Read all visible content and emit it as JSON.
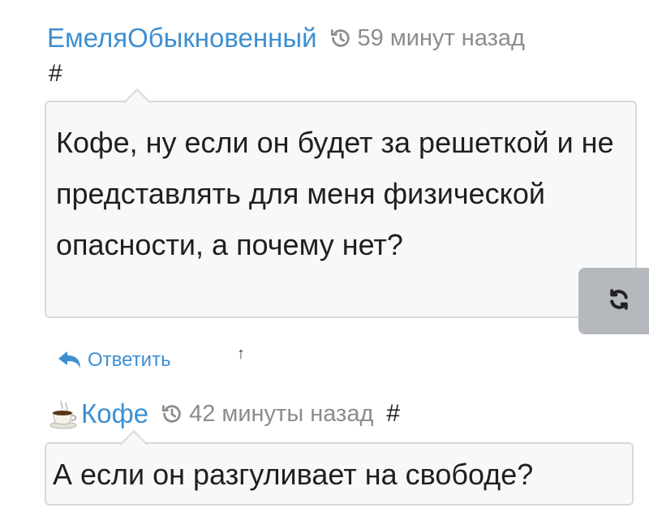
{
  "comment1": {
    "author": "ЕмеляОбыкновенный",
    "time": "59 минут назад",
    "hash": "#",
    "text": "Кофе, ну если он будет за решеткой и не представлять для меня физической опасности, а почему нет?"
  },
  "actions": {
    "reply_label": "Ответить",
    "up_arrow": "↑"
  },
  "comment2": {
    "author": "Кофе",
    "time": "42 минуты назад",
    "hash": "#",
    "text": "А если он разгуливает на свободе?"
  },
  "icons": {
    "history": "history-icon",
    "reply": "reply-arrow-icon",
    "refresh": "refresh-icon",
    "avatar": "coffee-cup-icon"
  },
  "colors": {
    "link": "#3d8fd1",
    "muted": "#8c8c8c",
    "bubble_bg": "#f7f8fa",
    "bubble_border": "#d7d9dd",
    "refresh_bg": "#b5b8bc"
  }
}
